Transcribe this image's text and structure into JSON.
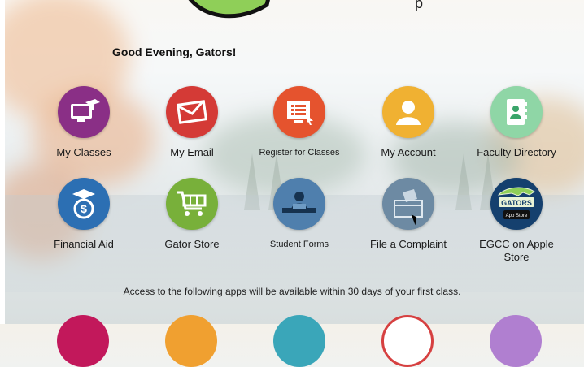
{
  "header": {
    "top_label": "p",
    "greeting": "Good Evening, Gators!"
  },
  "tiles": [
    {
      "label": "My Classes",
      "icon": "classes-icon",
      "color": "#8a2f86"
    },
    {
      "label": "My Email",
      "icon": "email-icon",
      "color": "#d43a36"
    },
    {
      "label": "Register for Classes",
      "icon": "register-icon",
      "color": "#e5532e"
    },
    {
      "label": "My Account",
      "icon": "account-icon",
      "color": "#f0b132"
    },
    {
      "label": "Faculty Directory",
      "icon": "directory-icon",
      "color": "#8fd6a6"
    },
    {
      "label": "Financial Aid",
      "icon": "financial-aid-icon",
      "color": "#2c6fb3"
    },
    {
      "label": "Gator Store",
      "icon": "cart-icon",
      "color": "#78b03a"
    },
    {
      "label": "Student Forms",
      "icon": "student-forms-icon",
      "color": "#4f7fad"
    },
    {
      "label": "File a Complaint",
      "icon": "ballot-box-icon",
      "color": "#6d8aa3"
    },
    {
      "label": "EGCC on Apple Store",
      "icon": "gators-app-icon",
      "color": "#15406e",
      "badge_text": "GATORS",
      "app_store_text": "App Store"
    }
  ],
  "notice": "Access to the following apps will be available within 30 days of your first class.",
  "lower_row_colors": [
    "#c2185b",
    "#f0a030",
    "#3aa6b9",
    "#d64040",
    "#b07fd0"
  ]
}
